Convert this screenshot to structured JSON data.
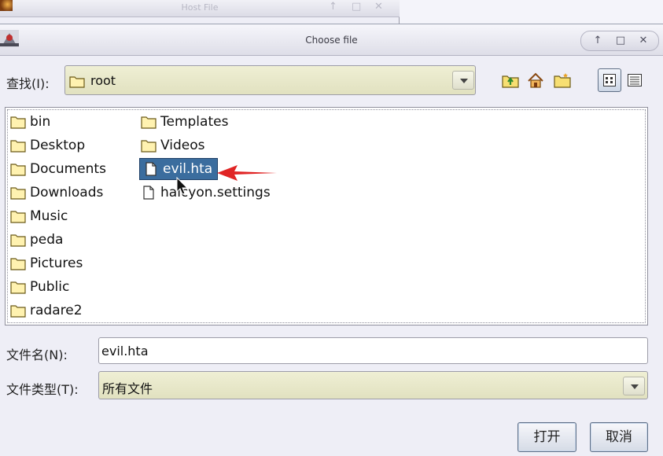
{
  "background_window": {
    "title": "Host File"
  },
  "dialog": {
    "title": "Choose file",
    "controls": {
      "up": "↑",
      "maximize": "□",
      "close": "✕"
    },
    "look_in": {
      "label": "查找(I):",
      "value": "root"
    },
    "toolbar": {
      "up_folder": "up-folder-icon",
      "home": "home-icon",
      "new_folder": "new-folder-icon",
      "list_view": "list-view-icon",
      "details_view": "details-view-icon"
    },
    "files": [
      {
        "name": "bin",
        "type": "folder"
      },
      {
        "name": "Desktop",
        "type": "folder"
      },
      {
        "name": "Documents",
        "type": "folder"
      },
      {
        "name": "Downloads",
        "type": "folder"
      },
      {
        "name": "Music",
        "type": "folder"
      },
      {
        "name": "peda",
        "type": "folder"
      },
      {
        "name": "Pictures",
        "type": "folder"
      },
      {
        "name": "Public",
        "type": "folder"
      },
      {
        "name": "radare2",
        "type": "folder"
      },
      {
        "name": "Templates",
        "type": "folder"
      },
      {
        "name": "Videos",
        "type": "folder"
      },
      {
        "name": "evil.hta",
        "type": "file",
        "selected": true
      },
      {
        "name": "halcyon.settings",
        "type": "file"
      }
    ],
    "file_name": {
      "label": "文件名(N):",
      "value": "evil.hta"
    },
    "file_type": {
      "label": "文件类型(T):",
      "value": "所有文件"
    },
    "buttons": {
      "open": "打开",
      "cancel": "取消"
    },
    "colors": {
      "selection": "#3b6d9e",
      "arrow_annotation": "#e02424",
      "combo_bg": "#e8e8cc"
    }
  }
}
